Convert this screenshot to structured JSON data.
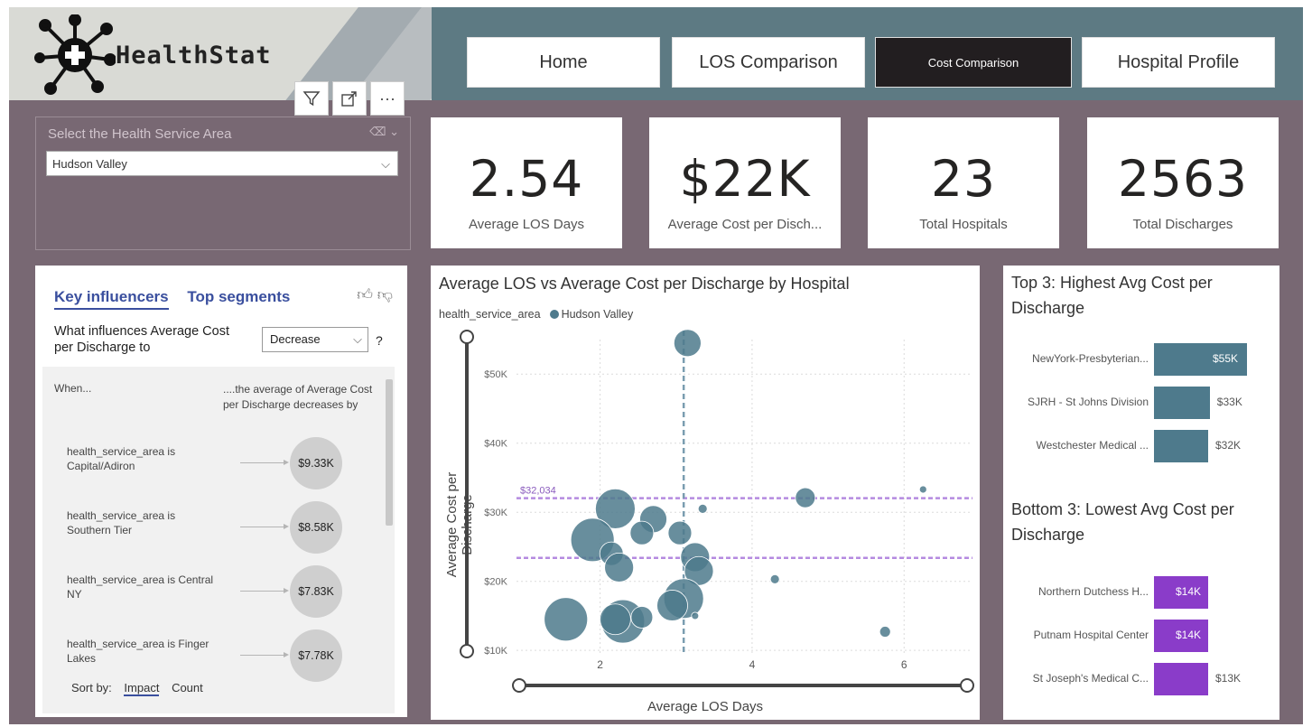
{
  "app": {
    "title": "HealthStat"
  },
  "visual_tools": {
    "filter_icon": "filter-icon",
    "focus_icon": "focus-mode-icon",
    "more_label": "···"
  },
  "nav": {
    "home": "Home",
    "los": "LOS Comparison",
    "cost": "Cost Comparison",
    "profile": "Hospital Profile",
    "active": "Cost Comparison"
  },
  "slicer": {
    "title": "Select the Health Service Area",
    "value": "Hudson Valley"
  },
  "kpis": [
    {
      "value": "2.54",
      "label": "Average LOS Days"
    },
    {
      "value": "$22K",
      "label": "Average Cost per Disch..."
    },
    {
      "value": "23",
      "label": "Total Hospitals"
    },
    {
      "value": "2563",
      "label": "Total Discharges"
    }
  ],
  "key_influencers": {
    "tab1": "Key influencers",
    "tab2": "Top segments",
    "question": "What influences Average Cost per Discharge to",
    "direction": "Decrease",
    "help": "?",
    "when_label": "When...",
    "avg_label": "....the average of Average Cost per Discharge decreases by",
    "rows": [
      {
        "text": "health_service_area is Capital/Adiron",
        "value": "$9.33K"
      },
      {
        "text": "health_service_area is Southern Tier",
        "value": "$8.58K"
      },
      {
        "text": "health_service_area is Central NY",
        "value": "$7.83K"
      },
      {
        "text": "health_service_area is Finger Lakes",
        "value": "$7.78K"
      }
    ],
    "sort_label": "Sort by:",
    "sort_impact": "Impact",
    "sort_count": "Count"
  },
  "scatter": {
    "title": "Average LOS vs Average Cost per Discharge by Hospital",
    "legend_field": "health_service_area",
    "legend_item": "Hudson Valley",
    "xlabel": "Average LOS Days",
    "ylabel": "Average Cost per Discharge",
    "ref_label": "$32,034"
  },
  "top3": {
    "title": "Top 3: Highest Avg Cost per Discharge"
  },
  "bottom3": {
    "title": "Bottom 3: Lowest Avg Cost per Discharge"
  },
  "colors": {
    "teal": "#4e7a8c",
    "purple": "#8a3cc9",
    "ref_line": "#b58be0",
    "accent_blue": "#3a4f9e"
  },
  "chart_data": [
    {
      "type": "scatter",
      "title": "Average LOS vs Average Cost per Discharge by Hospital",
      "xlabel": "Average LOS Days",
      "ylabel": "Average Cost per Discharge",
      "x_ticks": [
        2,
        4,
        6
      ],
      "y_ticks": [
        "$10K",
        "$20K",
        "$30K",
        "$40K",
        "$50K"
      ],
      "xlim": [
        0.9,
        6.9
      ],
      "ylim": [
        9500,
        55000
      ],
      "x_ref_line": 3.1,
      "y_ref_lines": [
        32034,
        23400
      ],
      "ref_label": "$32,034",
      "series": [
        {
          "name": "Hudson Valley",
          "points": [
            {
              "x": 3.15,
              "y": 54500,
              "size": 15
            },
            {
              "x": 2.2,
              "y": 30500,
              "size": 22
            },
            {
              "x": 2.7,
              "y": 29000,
              "size": 15
            },
            {
              "x": 3.35,
              "y": 30500,
              "size": 5
            },
            {
              "x": 4.7,
              "y": 32100,
              "size": 11
            },
            {
              "x": 6.25,
              "y": 33300,
              "size": 4
            },
            {
              "x": 1.9,
              "y": 26000,
              "size": 24
            },
            {
              "x": 2.55,
              "y": 27000,
              "size": 13
            },
            {
              "x": 3.05,
              "y": 27000,
              "size": 13
            },
            {
              "x": 2.15,
              "y": 24000,
              "size": 13
            },
            {
              "x": 2.25,
              "y": 22000,
              "size": 16
            },
            {
              "x": 3.25,
              "y": 23500,
              "size": 16
            },
            {
              "x": 3.3,
              "y": 21500,
              "size": 16
            },
            {
              "x": 4.3,
              "y": 20300,
              "size": 5
            },
            {
              "x": 3.1,
              "y": 17500,
              "size": 22
            },
            {
              "x": 2.95,
              "y": 16500,
              "size": 17
            },
            {
              "x": 1.55,
              "y": 14500,
              "size": 24
            },
            {
              "x": 2.3,
              "y": 14200,
              "size": 24
            },
            {
              "x": 2.2,
              "y": 14500,
              "size": 17
            },
            {
              "x": 2.55,
              "y": 14800,
              "size": 12
            },
            {
              "x": 3.25,
              "y": 15000,
              "size": 4
            },
            {
              "x": 5.75,
              "y": 12700,
              "size": 6
            }
          ]
        }
      ]
    },
    {
      "type": "bar",
      "title": "Top 3: Highest Avg Cost per Discharge",
      "categories": [
        "NewYork-Presbyterian...",
        "SJRH - St Johns Division",
        "Westchester Medical ..."
      ],
      "values": [
        55,
        33,
        32
      ],
      "labels": [
        "$55K",
        "$33K",
        "$32K"
      ],
      "color": "#4e7a8c"
    },
    {
      "type": "bar",
      "title": "Bottom 3: Lowest Avg Cost per Discharge",
      "categories": [
        "Northern Dutchess H...",
        "Putnam Hospital Center",
        "St Joseph's Medical C..."
      ],
      "values": [
        14,
        14,
        13
      ],
      "labels": [
        "$14K",
        "$14K",
        "$13K"
      ],
      "color": "#8a3cc9"
    }
  ]
}
